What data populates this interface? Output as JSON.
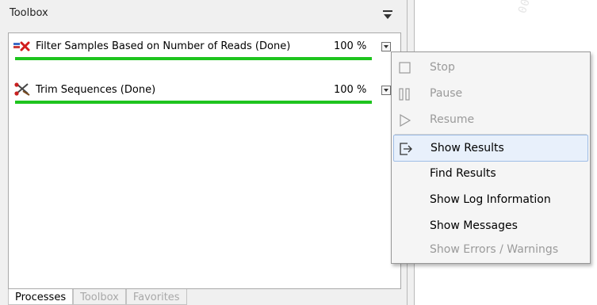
{
  "panel": {
    "title": "Toolbox"
  },
  "watermark": {
    "text": "001"
  },
  "processes": [
    {
      "name": "Filter Samples Based on Number of Reads (Done)",
      "percent_label": "100 %",
      "progress": 1.0,
      "icon": "filter-samples-icon"
    },
    {
      "name": "Trim Sequences (Done)",
      "percent_label": "100 %",
      "progress": 1.0,
      "icon": "trim-sequences-icon"
    }
  ],
  "tabs": [
    {
      "label": "Processes",
      "active": true
    },
    {
      "label": "Toolbox",
      "active": false
    },
    {
      "label": "Favorites",
      "active": false
    }
  ],
  "context_menu": {
    "items": [
      {
        "label": "Stop",
        "enabled": false,
        "icon": "stop-icon"
      },
      {
        "label": "Pause",
        "enabled": false,
        "icon": "pause-icon"
      },
      {
        "label": "Resume",
        "enabled": false,
        "icon": "resume-icon"
      },
      {
        "label": "Show Results",
        "enabled": true,
        "highlighted": true,
        "icon": "show-results-icon"
      },
      {
        "label": "Find Results",
        "enabled": true
      },
      {
        "label": "Show Log Information",
        "enabled": true
      },
      {
        "label": "Show Messages",
        "enabled": true
      },
      {
        "label": "Show Errors / Warnings",
        "enabled": false
      }
    ]
  },
  "colors": {
    "progress_fill": "#1ec41e",
    "menu_highlight": "#e8f0fb",
    "disabled_text": "#9a9a9a"
  }
}
